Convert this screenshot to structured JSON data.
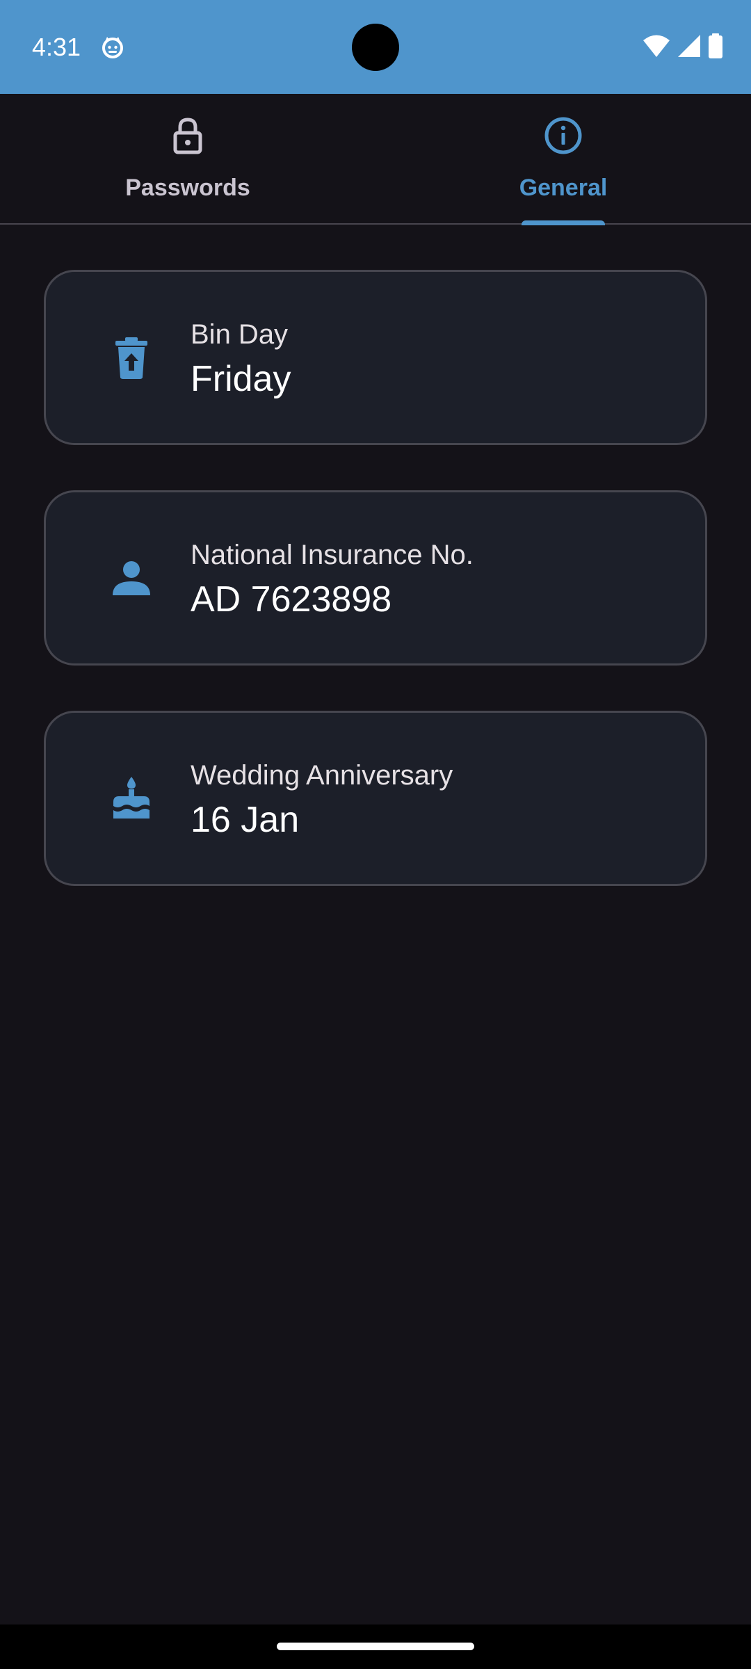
{
  "status_bar": {
    "time": "4:31",
    "app_icon": "cat-face-icon",
    "icons": [
      "wifi-icon",
      "cellular-signal-icon",
      "battery-icon"
    ],
    "color": "#4f95cc"
  },
  "tabs": [
    {
      "label": "Passwords",
      "icon": "lock-icon",
      "selected": false
    },
    {
      "label": "General",
      "icon": "info-icon",
      "selected": true
    }
  ],
  "cards": [
    {
      "icon": "trash-bin-icon",
      "label": "Bin Day",
      "value": "Friday"
    },
    {
      "icon": "person-icon",
      "label": "National Insurance No.",
      "value": "AD 7623898"
    },
    {
      "icon": "cake-icon",
      "label": "Wedding Anniversary",
      "value": "16 Jan"
    }
  ],
  "colors": {
    "accent": "#4f95cc",
    "background": "#141218",
    "card_background": "#1c1f29",
    "card_border": "#46464f"
  }
}
